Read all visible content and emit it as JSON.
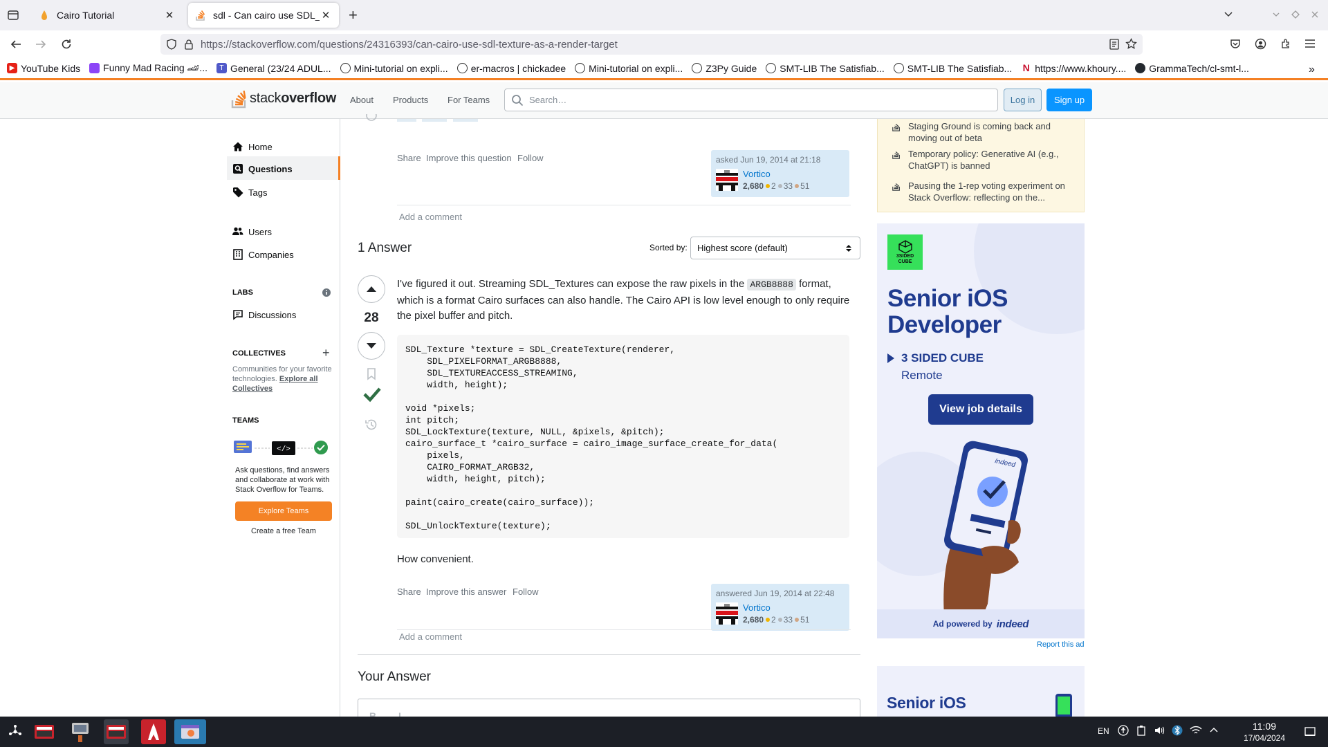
{
  "browser": {
    "tabs": [
      {
        "title": "Cairo Tutorial",
        "active": false
      },
      {
        "title": "sdl - Can cairo use SDL_Tex",
        "active": true
      }
    ],
    "url_host": "https://stackoverflow.com",
    "url_path": "/questions/24316393/can-cairo-use-sdl-texture-as-a-render-target",
    "bookmarks": [
      "YouTube Kids",
      "Funny Mad Racing 🏎...",
      "General (23/24 ADUL...",
      "Mini-tutorial on expli...",
      "er-macros | chickadee",
      "Mini-tutorial on expli...",
      "Z3Py Guide",
      "SMT-LIB The Satisfiab...",
      "SMT-LIB The Satisfiab...",
      "https://www.khoury....",
      "GrammaTech/cl-smt-l..."
    ]
  },
  "header": {
    "logo_part1": "stack",
    "logo_part2": "overflow",
    "nav": [
      "About",
      "Products",
      "For Teams"
    ],
    "search_placeholder": "Search…",
    "login": "Log in",
    "signup": "Sign up"
  },
  "sidebar": {
    "home": "Home",
    "questions": "Questions",
    "tags": "Tags",
    "users": "Users",
    "companies": "Companies",
    "labs_heading": "LABS",
    "discussions": "Discussions",
    "collectives_heading": "COLLECTIVES",
    "collectives_text": "Communities for your favorite technologies.",
    "collectives_link": "Explore all Collectives",
    "teams_heading": "TEAMS",
    "teams_text": "Ask questions, find answers and collaborate at work with Stack Overflow for Teams.",
    "explore_teams": "Explore Teams",
    "create_team": "Create a free Team"
  },
  "question": {
    "actions": [
      "Share",
      "Improve this question",
      "Follow"
    ],
    "asked": "asked Jun 19, 2014 at 21:18",
    "user": "Vortico",
    "rep": "2,680",
    "gold": "2",
    "silver": "33",
    "bronze": "51",
    "add_comment": "Add a comment"
  },
  "answers": {
    "count_label": "1 Answer",
    "sorted_by": "Sorted by:",
    "sort_value": "Highest score (default)",
    "score": "28",
    "body_before": "I've figured it out. Streaming SDL_Textures can expose the raw pixels in the",
    "inline_code": "ARGB8888",
    "body_after": "format, which is a format Cairo surfaces can also handle. The Cairo API is low level enough to only require the pixel buffer and pitch.",
    "code": "SDL_Texture *texture = SDL_CreateTexture(renderer,\n    SDL_PIXELFORMAT_ARGB8888,\n    SDL_TEXTUREACCESS_STREAMING,\n    width, height);\n\nvoid *pixels;\nint pitch;\nSDL_LockTexture(texture, NULL, &pixels, &pitch);\ncairo_surface_t *cairo_surface = cairo_image_surface_create_for_data(\n    pixels,\n    CAIRO_FORMAT_ARGB32,\n    width, height, pitch);\n\npaint(cairo_create(cairo_surface));\n\nSDL_UnlockTexture(texture);",
    "closing": "How convenient.",
    "actions": [
      "Share",
      "Improve this answer",
      "Follow"
    ],
    "answered": "answered Jun 19, 2014 at 22:48",
    "user": "Vortico",
    "rep": "2,680",
    "gold": "2",
    "silver": "33",
    "bronze": "51",
    "add_comment": "Add a comment",
    "your_answer": "Your Answer"
  },
  "blog": [
    "Staging Ground is coming back and moving out of beta",
    "Temporary policy: Generative AI (e.g., ChatGPT) is banned",
    "Pausing the 1-rep voting experiment on Stack Overflow: reflecting on the..."
  ],
  "ad": {
    "logo_text": "3SIDED CUBE",
    "title": "Senior iOS Developer",
    "company": "3 SIDED CUBE",
    "location": "Remote",
    "cta": "View job details",
    "phone_brand": "indeed",
    "powered": "Ad powered by",
    "powered_brand": "indeed",
    "report": "Report this ad",
    "title2": "Senior iOS"
  },
  "taskbar": {
    "lang": "EN",
    "time": "11:09",
    "date": "17/04/2024"
  },
  "colors": {
    "so_orange": "#f48024",
    "so_blue": "#0a95ff",
    "accepted_green": "#2f6f44",
    "ad_navy": "#1f3b8f"
  }
}
